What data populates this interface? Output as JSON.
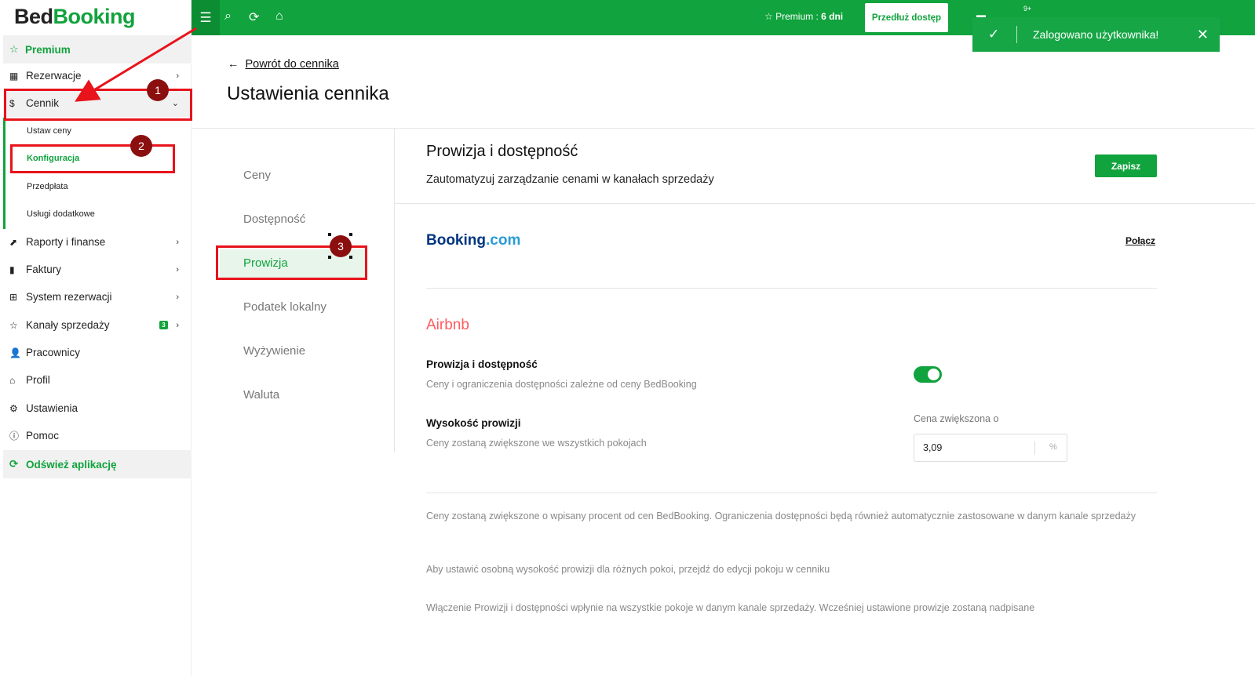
{
  "app": {
    "logo_bed": "Bed",
    "logo_booking": "Booking"
  },
  "sidebar": {
    "premium": "Premium",
    "items": [
      {
        "label": "Rezerwacje"
      },
      {
        "label": "Cennik"
      },
      {
        "label": "Raporty i finanse"
      },
      {
        "label": "Faktury"
      },
      {
        "label": "System rezerwacji"
      },
      {
        "label": "Kanały sprzedaży",
        "badge": "3"
      },
      {
        "label": "Pracownicy"
      },
      {
        "label": "Profil"
      },
      {
        "label": "Ustawienia"
      },
      {
        "label": "Pomoc"
      }
    ],
    "subitems": [
      {
        "label": "Ustaw ceny"
      },
      {
        "label": "Konfiguracja"
      },
      {
        "label": "Przedpłata"
      },
      {
        "label": "Usługi dodatkowe"
      }
    ],
    "refresh": "Odśwież aplikację"
  },
  "topbar": {
    "premium_label": "Premium :",
    "premium_days": "6 dni",
    "extend_button": "Przedłuż dostęp",
    "notif_count": "9+"
  },
  "toast": {
    "message": "Zalogowano użytkownika!"
  },
  "header": {
    "back_link": "Powrót do cennika",
    "title": "Ustawienia cennika"
  },
  "tabs": [
    {
      "label": "Ceny"
    },
    {
      "label": "Dostępność"
    },
    {
      "label": "Prowizja"
    },
    {
      "label": "Podatek lokalny"
    },
    {
      "label": "Wyżywienie"
    },
    {
      "label": "Waluta"
    }
  ],
  "content": {
    "title": "Prowizja i dostępność",
    "subtitle": "Zautomatyzuj zarządzanie cenami w kanałach sprzedaży",
    "save_button": "Zapisz",
    "booking_name": "Booking",
    "booking_suffix": ".com",
    "connect_link": "Połącz",
    "airbnb_name": "Airbnb",
    "row1_title": "Prowizja i dostępność",
    "row1_desc": "Ceny i ograniczenia dostępności zależne od ceny BedBooking",
    "row1_toggle_on": true,
    "row2_title": "Wysokość prowizji",
    "row2_desc": "Ceny zostaną zwiększone we wszystkich pokojach",
    "field_label": "Cena zwiększona o",
    "field_value": "3,09",
    "field_unit": "%",
    "notes": [
      "Ceny zostaną zwiększone o wpisany procent od cen BedBooking. Ograniczenia dostępności będą również automatycznie zastosowane w danym kanale sprzedaży",
      "Aby ustawić osobną wysokość prowizji dla różnych pokoi, przejdź do edycji pokoju w cenniku",
      "Włączenie Prowizji i dostępności wpłynie na wszystkie pokoje w danym kanale sprzedaży. Wcześniej ustawione prowizje zostaną nadpisane"
    ]
  },
  "annotations": {
    "step1": "1",
    "step2": "2",
    "step3": "3",
    "color": "#e8131b"
  }
}
